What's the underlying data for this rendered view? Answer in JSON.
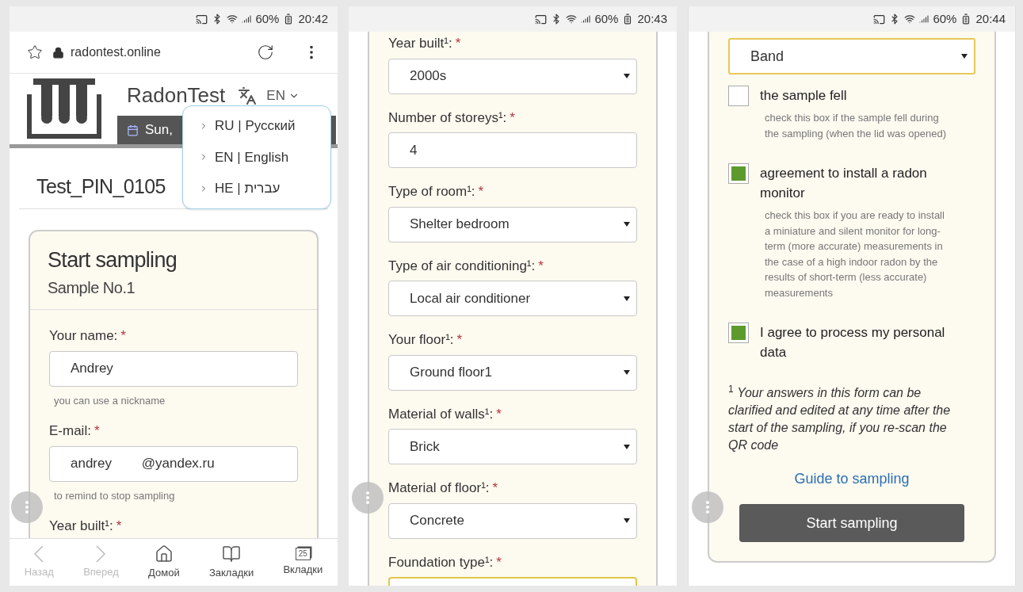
{
  "screenshots": [
    {
      "status_bar": {
        "battery": "60%",
        "time": "20:42"
      },
      "browser_bar": {
        "url": "radontest.online"
      },
      "site_header": {
        "brand": "RadonTest",
        "language": "EN",
        "date": "Sun,"
      },
      "language_menu": [
        {
          "label": "RU | Русский"
        },
        {
          "label": "EN | English"
        },
        {
          "label": "HE | עברית"
        }
      ],
      "page_title": "Test_PIN_0105",
      "card": {
        "title": "Start sampling",
        "subtitle": "Sample No.1"
      },
      "fields": [
        {
          "kind": "text",
          "label": "Your name:",
          "required_mark": "*",
          "value": "Andrey",
          "hint": "you can use a nickname"
        },
        {
          "kind": "text",
          "label": "E-mail:",
          "required_mark": "*",
          "value": "andrey        @yandex.ru",
          "hint": "to remind to stop sampling"
        },
        {
          "kind": "text",
          "label": "Year built¹:",
          "required_mark": "*"
        }
      ],
      "bottom_nav": [
        {
          "label": "Назад",
          "disabled": true
        },
        {
          "label": "Вперед",
          "disabled": true
        },
        {
          "label": "Домой",
          "disabled": false
        },
        {
          "label": "Закладки",
          "disabled": false
        },
        {
          "label": "Вкладки",
          "disabled": false,
          "badge": "25"
        }
      ]
    },
    {
      "status_bar": {
        "battery": "60%",
        "time": "20:43"
      },
      "fields": [
        {
          "kind": "select",
          "label": "Year built¹:",
          "required_mark": "*",
          "value": "2000s"
        },
        {
          "kind": "text",
          "label": "Number of storeys¹:",
          "required_mark": "*",
          "value": "4"
        },
        {
          "kind": "select",
          "label": "Type of room¹:",
          "required_mark": "*",
          "value": "Shelter bedroom"
        },
        {
          "kind": "select",
          "label": "Type of air conditioning¹:",
          "required_mark": "*",
          "value": "Local air conditioner"
        },
        {
          "kind": "select",
          "label": "Your floor¹:",
          "required_mark": "*",
          "value": "Ground floor1"
        },
        {
          "kind": "select",
          "label": "Material of walls¹:",
          "required_mark": "*",
          "value": "Brick"
        },
        {
          "kind": "select",
          "label": "Material of floor¹:",
          "required_mark": "*",
          "value": "Concrete"
        },
        {
          "kind": "select",
          "label": "Foundation type¹:",
          "required_mark": "*"
        }
      ]
    },
    {
      "status_bar": {
        "battery": "60%",
        "time": "20:44"
      },
      "fields": [
        {
          "kind": "select",
          "value": "Band"
        }
      ],
      "checkboxes": [
        {
          "label": "the sample fell",
          "checked": false,
          "hint": "check this box if the sample fell during the sampling (when the lid was opened)"
        },
        {
          "label": "agreement to install a radon monitor",
          "checked": true,
          "hint": "check this box if you are ready to install a miniature and silent monitor for long-term (more accurate) measurements in the case of a high indoor radon by the results of short-term (less accurate) measurements"
        },
        {
          "label": "I agree to process my personal data",
          "checked": true
        }
      ],
      "footnote": "$^{1}$ *Your answers in this form can be clarified and edited at any time after the start of the sampling, if you re-scan the QR code*",
      "link": "Guide to sampling",
      "submit_button": "Start sampling"
    }
  ]
}
